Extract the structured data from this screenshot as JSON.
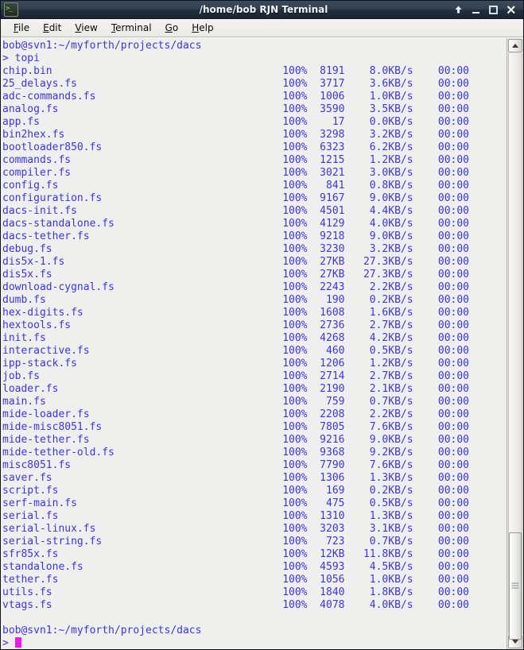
{
  "window": {
    "title": "/home/bob RJN Terminal",
    "icon": "terminal-icon",
    "buttons": [
      {
        "name": "shade-button",
        "glyph": "up-arrow-icon"
      },
      {
        "name": "minimize-button",
        "glyph": "minimize-icon"
      },
      {
        "name": "maximize-button",
        "glyph": "maximize-icon"
      },
      {
        "name": "close-button",
        "glyph": "close-icon"
      }
    ]
  },
  "menubar": {
    "items": [
      {
        "mnemonic": "F",
        "rest": "ile"
      },
      {
        "mnemonic": "E",
        "rest": "dit"
      },
      {
        "mnemonic": "V",
        "rest": "iew"
      },
      {
        "mnemonic": "T",
        "rest": "erminal"
      },
      {
        "mnemonic": "G",
        "rest": "o"
      },
      {
        "mnemonic": "H",
        "rest": "elp"
      }
    ]
  },
  "terminal": {
    "colors": {
      "background": "#efefed",
      "foreground": "#3b34e8",
      "cursor": "#f017f0"
    },
    "prompt_line": "bob@svn1:~/myforth/projects/dacs",
    "command_line": "> topi",
    "final_prompt_line": "bob@svn1:~/myforth/projects/dacs",
    "final_command_prefix": "> ",
    "columns": {
      "percent": "100%",
      "eta": "00:00"
    },
    "transfers": [
      {
        "name": "chip.bin",
        "percent": "100%",
        "size": "8191",
        "rate": "8.0KB/s",
        "eta": "00:00"
      },
      {
        "name": "25_delays.fs",
        "percent": "100%",
        "size": "3717",
        "rate": "3.6KB/s",
        "eta": "00:00"
      },
      {
        "name": "adc-commands.fs",
        "percent": "100%",
        "size": "1006",
        "rate": "1.0KB/s",
        "eta": "00:00"
      },
      {
        "name": "analog.fs",
        "percent": "100%",
        "size": "3590",
        "rate": "3.5KB/s",
        "eta": "00:00"
      },
      {
        "name": "app.fs",
        "percent": "100%",
        "size": "17",
        "rate": "0.0KB/s",
        "eta": "00:00"
      },
      {
        "name": "bin2hex.fs",
        "percent": "100%",
        "size": "3298",
        "rate": "3.2KB/s",
        "eta": "00:00"
      },
      {
        "name": "bootloader850.fs",
        "percent": "100%",
        "size": "6323",
        "rate": "6.2KB/s",
        "eta": "00:00"
      },
      {
        "name": "commands.fs",
        "percent": "100%",
        "size": "1215",
        "rate": "1.2KB/s",
        "eta": "00:00"
      },
      {
        "name": "compiler.fs",
        "percent": "100%",
        "size": "3021",
        "rate": "3.0KB/s",
        "eta": "00:00"
      },
      {
        "name": "config.fs",
        "percent": "100%",
        "size": "841",
        "rate": "0.8KB/s",
        "eta": "00:00"
      },
      {
        "name": "configuration.fs",
        "percent": "100%",
        "size": "9167",
        "rate": "9.0KB/s",
        "eta": "00:00"
      },
      {
        "name": "dacs-init.fs",
        "percent": "100%",
        "size": "4501",
        "rate": "4.4KB/s",
        "eta": "00:00"
      },
      {
        "name": "dacs-standalone.fs",
        "percent": "100%",
        "size": "4129",
        "rate": "4.0KB/s",
        "eta": "00:00"
      },
      {
        "name": "dacs-tether.fs",
        "percent": "100%",
        "size": "9218",
        "rate": "9.0KB/s",
        "eta": "00:00"
      },
      {
        "name": "debug.fs",
        "percent": "100%",
        "size": "3230",
        "rate": "3.2KB/s",
        "eta": "00:00"
      },
      {
        "name": "dis5x-1.fs",
        "percent": "100%",
        "size": "27KB",
        "rate": "27.3KB/s",
        "eta": "00:00"
      },
      {
        "name": "dis5x.fs",
        "percent": "100%",
        "size": "27KB",
        "rate": "27.3KB/s",
        "eta": "00:00"
      },
      {
        "name": "download-cygnal.fs",
        "percent": "100%",
        "size": "2243",
        "rate": "2.2KB/s",
        "eta": "00:00"
      },
      {
        "name": "dumb.fs",
        "percent": "100%",
        "size": "190",
        "rate": "0.2KB/s",
        "eta": "00:00"
      },
      {
        "name": "hex-digits.fs",
        "percent": "100%",
        "size": "1608",
        "rate": "1.6KB/s",
        "eta": "00:00"
      },
      {
        "name": "hextools.fs",
        "percent": "100%",
        "size": "2736",
        "rate": "2.7KB/s",
        "eta": "00:00"
      },
      {
        "name": "init.fs",
        "percent": "100%",
        "size": "4268",
        "rate": "4.2KB/s",
        "eta": "00:00"
      },
      {
        "name": "interactive.fs",
        "percent": "100%",
        "size": "460",
        "rate": "0.5KB/s",
        "eta": "00:00"
      },
      {
        "name": "ipp-stack.fs",
        "percent": "100%",
        "size": "1206",
        "rate": "1.2KB/s",
        "eta": "00:00"
      },
      {
        "name": "job.fs",
        "percent": "100%",
        "size": "2714",
        "rate": "2.7KB/s",
        "eta": "00:00"
      },
      {
        "name": "loader.fs",
        "percent": "100%",
        "size": "2190",
        "rate": "2.1KB/s",
        "eta": "00:00"
      },
      {
        "name": "main.fs",
        "percent": "100%",
        "size": "759",
        "rate": "0.7KB/s",
        "eta": "00:00"
      },
      {
        "name": "mide-loader.fs",
        "percent": "100%",
        "size": "2208",
        "rate": "2.2KB/s",
        "eta": "00:00"
      },
      {
        "name": "mide-misc8051.fs",
        "percent": "100%",
        "size": "7805",
        "rate": "7.6KB/s",
        "eta": "00:00"
      },
      {
        "name": "mide-tether.fs",
        "percent": "100%",
        "size": "9216",
        "rate": "9.0KB/s",
        "eta": "00:00"
      },
      {
        "name": "mide-tether-old.fs",
        "percent": "100%",
        "size": "9368",
        "rate": "9.2KB/s",
        "eta": "00:00"
      },
      {
        "name": "misc8051.fs",
        "percent": "100%",
        "size": "7790",
        "rate": "7.6KB/s",
        "eta": "00:00"
      },
      {
        "name": "saver.fs",
        "percent": "100%",
        "size": "1306",
        "rate": "1.3KB/s",
        "eta": "00:00"
      },
      {
        "name": "script.fs",
        "percent": "100%",
        "size": "169",
        "rate": "0.2KB/s",
        "eta": "00:00"
      },
      {
        "name": "serf-main.fs",
        "percent": "100%",
        "size": "475",
        "rate": "0.5KB/s",
        "eta": "00:00"
      },
      {
        "name": "serial.fs",
        "percent": "100%",
        "size": "1310",
        "rate": "1.3KB/s",
        "eta": "00:00"
      },
      {
        "name": "serial-linux.fs",
        "percent": "100%",
        "size": "3203",
        "rate": "3.1KB/s",
        "eta": "00:00"
      },
      {
        "name": "serial-string.fs",
        "percent": "100%",
        "size": "723",
        "rate": "0.7KB/s",
        "eta": "00:00"
      },
      {
        "name": "sfr85x.fs",
        "percent": "100%",
        "size": "12KB",
        "rate": "11.8KB/s",
        "eta": "00:00"
      },
      {
        "name": "standalone.fs",
        "percent": "100%",
        "size": "4593",
        "rate": "4.5KB/s",
        "eta": "00:00"
      },
      {
        "name": "tether.fs",
        "percent": "100%",
        "size": "1056",
        "rate": "1.0KB/s",
        "eta": "00:00"
      },
      {
        "name": "utils.fs",
        "percent": "100%",
        "size": "1840",
        "rate": "1.8KB/s",
        "eta": "00:00"
      },
      {
        "name": "vtags.fs",
        "percent": "100%",
        "size": "4078",
        "rate": "4.0KB/s",
        "eta": "00:00"
      }
    ]
  },
  "scrollbar": {
    "up_arrow": "scroll-up-icon",
    "down_arrow": "scroll-down-icon",
    "thumb_top_percent": 82.5,
    "thumb_height_percent": 18.5
  }
}
